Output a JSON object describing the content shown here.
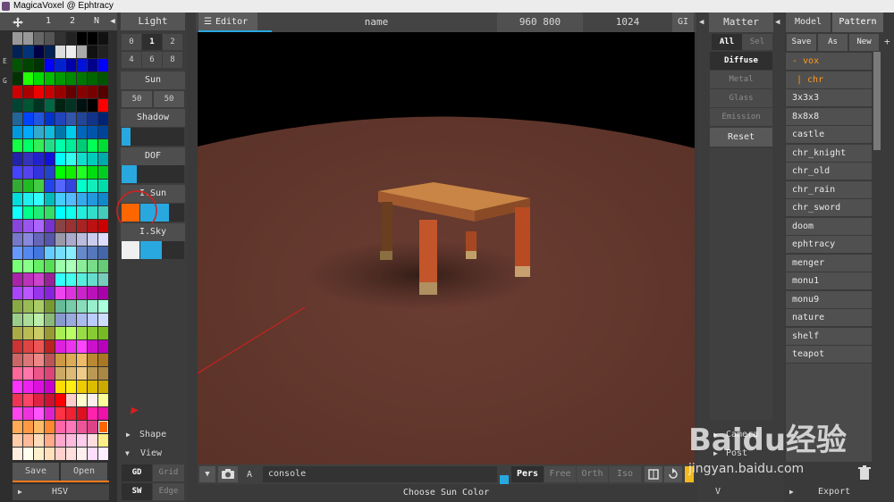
{
  "window": {
    "title": "MagicaVoxel @ Ephtracy"
  },
  "palette": {
    "tabs": [
      "1",
      "2",
      "N"
    ],
    "side_labels": [
      "E",
      "G"
    ],
    "swatches": [
      [
        "#999999",
        "#999999",
        "#666666",
        "#555555",
        "#333333",
        "#222222",
        "#000000",
        "#000000",
        "#111111"
      ],
      [
        "#002255",
        "#003377",
        "#000044",
        "#002255",
        "#dddddd",
        "#eeeeee",
        "#aaaaaa",
        "#111111",
        "#222222"
      ],
      [
        "#005500",
        "#004400",
        "#003300",
        "#0000ff",
        "#0022cc",
        "#0000aa",
        "#0011dd",
        "#000088",
        "#0000ff"
      ],
      [
        "#003300",
        "#22ff00",
        "#00dd00",
        "#00bb00",
        "#009900",
        "#008800",
        "#007700",
        "#006600",
        "#005500"
      ],
      [
        "#cc0000",
        "#aa0000",
        "#ee0000",
        "#cc0000",
        "#990000",
        "#660000",
        "#880000",
        "#770000",
        "#550000"
      ],
      [
        "#004433",
        "#005533",
        "#003322",
        "#006644",
        "#002211",
        "#003322",
        "#001111",
        "#000000",
        "#ff0000"
      ],
      [
        "#226699",
        "#0044ff",
        "#2255dd",
        "#0033cc",
        "#2244bb",
        "#3355aa",
        "#224499",
        "#113388",
        "#002277"
      ],
      [
        "#0099dd",
        "#00aaff",
        "#33aacc",
        "#11bbdd",
        "#0077aa",
        "#00ccee",
        "#0066bb",
        "#0055aa",
        "#004499"
      ],
      [
        "#11ff44",
        "#00ff66",
        "#33ee55",
        "#22dd88",
        "#00ffaa",
        "#00ee99",
        "#00cc77",
        "#00ff55",
        "#00dd33"
      ],
      [
        "#2222aa",
        "#3333bb",
        "#2222cc",
        "#1111dd",
        "#00ffff",
        "#33ffee",
        "#11ddcc",
        "#00ccbb",
        "#00aaaa"
      ],
      [
        "#4444ff",
        "#5544ee",
        "#3333dd",
        "#2244cc",
        "#00ff00",
        "#11ee00",
        "#22ff22",
        "#00dd11",
        "#00cc22"
      ],
      [
        "#33aa33",
        "#22bb22",
        "#44cc44",
        "#2244ee",
        "#5566ff",
        "#3344dd",
        "#00ffcc",
        "#11eebb",
        "#00ddaa"
      ],
      [
        "#00dddd",
        "#22eeee",
        "#33ffff",
        "#00bbbb",
        "#44ccff",
        "#55bbff",
        "#33aaee",
        "#2299dd",
        "#1188cc"
      ],
      [
        "#11ffff",
        "#00ff88",
        "#22ee77",
        "#33dd66",
        "#00ffff",
        "#11ffee",
        "#22eedd",
        "#33ddcc",
        "#44ccbb"
      ],
      [
        "#8844dd",
        "#9955ee",
        "#aa66ff",
        "#7733cc",
        "#884444",
        "#993333",
        "#aa2222",
        "#bb1111",
        "#cc0000"
      ],
      [
        "#7777cc",
        "#8888dd",
        "#6666bb",
        "#5555aa",
        "#9999aa",
        "#aaaacc",
        "#bbbbdd",
        "#ccccee",
        "#ddddff"
      ],
      [
        "#6699ff",
        "#5588ee",
        "#4477dd",
        "#66ccff",
        "#77ddff",
        "#88eeff",
        "#6688cc",
        "#5577bb",
        "#4466aa"
      ],
      [
        "#77ff77",
        "#88ff88",
        "#66ee66",
        "#55dd55",
        "#99ffaa",
        "#aaffbb",
        "#88ee99",
        "#77dd88",
        "#66cc77"
      ],
      [
        "#aa22aa",
        "#bb33bb",
        "#cc44cc",
        "#992299",
        "#33ffff",
        "#44ffee",
        "#55eedd",
        "#66ddcc",
        "#77ccbb"
      ],
      [
        "#aa44ff",
        "#bb55ff",
        "#9933ee",
        "#8822dd",
        "#ee44ee",
        "#dd33dd",
        "#cc22cc",
        "#bb11bb",
        "#aa00aa"
      ],
      [
        "#88aa44",
        "#99bb55",
        "#aacc66",
        "#779933",
        "#66bb99",
        "#77ccaa",
        "#88ddbb",
        "#99eecc",
        "#aaffdd"
      ],
      [
        "#99cc88",
        "#aadd99",
        "#bbeeaa",
        "#88bb77",
        "#8899cc",
        "#99aadd",
        "#aabbee",
        "#bbccff",
        "#ccddff"
      ],
      [
        "#aaaa44",
        "#bbbb55",
        "#cccc66",
        "#999933",
        "#aaee55",
        "#bbff66",
        "#99dd44",
        "#88cc33",
        "#77bb22"
      ],
      [
        "#cc3333",
        "#dd4444",
        "#ee5555",
        "#bb2222",
        "#dd22dd",
        "#ee33ee",
        "#ff44ff",
        "#cc11cc",
        "#bb00bb"
      ],
      [
        "#cc6666",
        "#dd7777",
        "#ee8888",
        "#bb5555",
        "#cc9944",
        "#ddaa55",
        "#eebb66",
        "#bb8833",
        "#aa7722"
      ],
      [
        "#ff6699",
        "#ff77aa",
        "#ee5588",
        "#dd4477",
        "#ccaa66",
        "#ddbb77",
        "#eecc88",
        "#bb9955",
        "#aa8844"
      ],
      [
        "#ff33ff",
        "#ee22ee",
        "#dd11dd",
        "#cc00cc",
        "#ffdd00",
        "#ffee11",
        "#eecc00",
        "#ddbb00",
        "#ccaa00"
      ],
      [
        "#ee3355",
        "#ff4466",
        "#dd2244",
        "#cc1133",
        "#ff0000",
        "#ffcccc",
        "#ffffcc",
        "#ffeeee",
        "#ffff99"
      ],
      [
        "#ff44ee",
        "#ee33dd",
        "#ff55ff",
        "#dd22cc",
        "#ff3344",
        "#ee2233",
        "#dd1122",
        "#ff22aa",
        "#ee11aa"
      ],
      [
        "#ffaa55",
        "#ff9944",
        "#ffbb66",
        "#ff8833",
        "#ff66aa",
        "#ff77bb",
        "#ee5599",
        "#dd4488",
        "#ff6600"
      ],
      [
        "#ffccaa",
        "#ffbb99",
        "#ffddbb",
        "#ffaa88",
        "#ffaacc",
        "#ffbbdd",
        "#ffccee",
        "#ffdde0",
        "#ffee88"
      ],
      [
        "#ffeedd",
        "#ffffee",
        "#fff0cc",
        "#ffe0bb",
        "#ffd0cc",
        "#ffe0dd",
        "#fff0ee",
        "#ffddff",
        "#ffeeff"
      ]
    ],
    "save_label": "Save",
    "open_label": "Open",
    "hsv_label": "HSV"
  },
  "light": {
    "header": "Light",
    "row1": [
      "0",
      "1",
      "2"
    ],
    "row2": [
      "4",
      "6",
      "8"
    ],
    "sun_label": "Sun",
    "sun_values": [
      "50",
      "50"
    ],
    "shadow_label": "Shadow",
    "dof_label": "DOF",
    "isun_label": "I.Sun",
    "isky_label": "I.Sky",
    "isun_color": "#ff6600",
    "accent_color": "#29a8e0",
    "sky_white": "#f0f0f0",
    "shape_label": "Shape",
    "view_label": "View",
    "gd_label": "GD",
    "grid_label": "Grid",
    "sw_label": "SW",
    "edge_label": "Edge"
  },
  "editor": {
    "tab_label": "Editor",
    "name_label": "name",
    "size_label": "960 800",
    "samples_label": "1024",
    "gi_label": "GI",
    "console_label": "console",
    "a_label": "A",
    "modes": [
      "Pers",
      "Free",
      "Orth",
      "Iso"
    ],
    "status": "Choose Sun Color",
    "floor_color": "#6e3f33"
  },
  "matter": {
    "header": "Matter",
    "all_label": "All",
    "sel_label": "Sel",
    "materials": [
      "Diffuse",
      "Metal",
      "Glass",
      "Emission"
    ],
    "reset_label": "Reset",
    "camera_label": "Camera",
    "post_label": "Post",
    "v_label": "V"
  },
  "model": {
    "tab_model": "Model",
    "tab_pattern": "Pattern",
    "save_label": "Save",
    "as_label": "As",
    "new_label": "New",
    "plus_label": "+",
    "files": [
      "- vox",
      "| chr",
      "3x3x3",
      "8x8x8",
      "castle",
      "chr_knight",
      "chr_old",
      "chr_rain",
      "chr_sword",
      "doom",
      "ephtracy",
      "menger",
      "monu1",
      "monu9",
      "nature",
      "shelf",
      "teapot"
    ],
    "export_label": "Export"
  },
  "watermark": {
    "text": "Baidu经验",
    "url": "jingyan.baidu.com"
  }
}
